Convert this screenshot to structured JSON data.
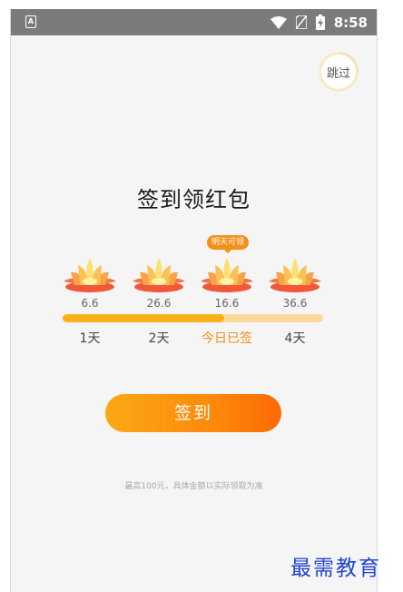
{
  "status_bar": {
    "left_icon": "A",
    "icons": [
      "wifi-icon",
      "no-sim-icon",
      "battery-charging-icon"
    ],
    "time": "8:58"
  },
  "skip_label": "跳过",
  "title": "签到领红包",
  "tooltip": "明天可领",
  "days": [
    {
      "amount": "6.6",
      "label": "1天",
      "today": false
    },
    {
      "amount": "26.6",
      "label": "2天",
      "today": false
    },
    {
      "amount": "16.6",
      "label": "今日已签",
      "today": true
    },
    {
      "amount": "36.6",
      "label": "4天",
      "today": false
    }
  ],
  "progress": {
    "completed_days": 3,
    "total_days": 4,
    "fraction": 0.62
  },
  "signin_button": "签到",
  "note": "最高100元，具体金额以实际领取为准",
  "watermark": "最需教育",
  "colors": {
    "accent": "#f29018",
    "progress_fill": "#f9b21c",
    "progress_track": "#fcd99a",
    "button_start": "#fca815",
    "button_end": "#fd6a05",
    "watermark": "#2244cc"
  }
}
